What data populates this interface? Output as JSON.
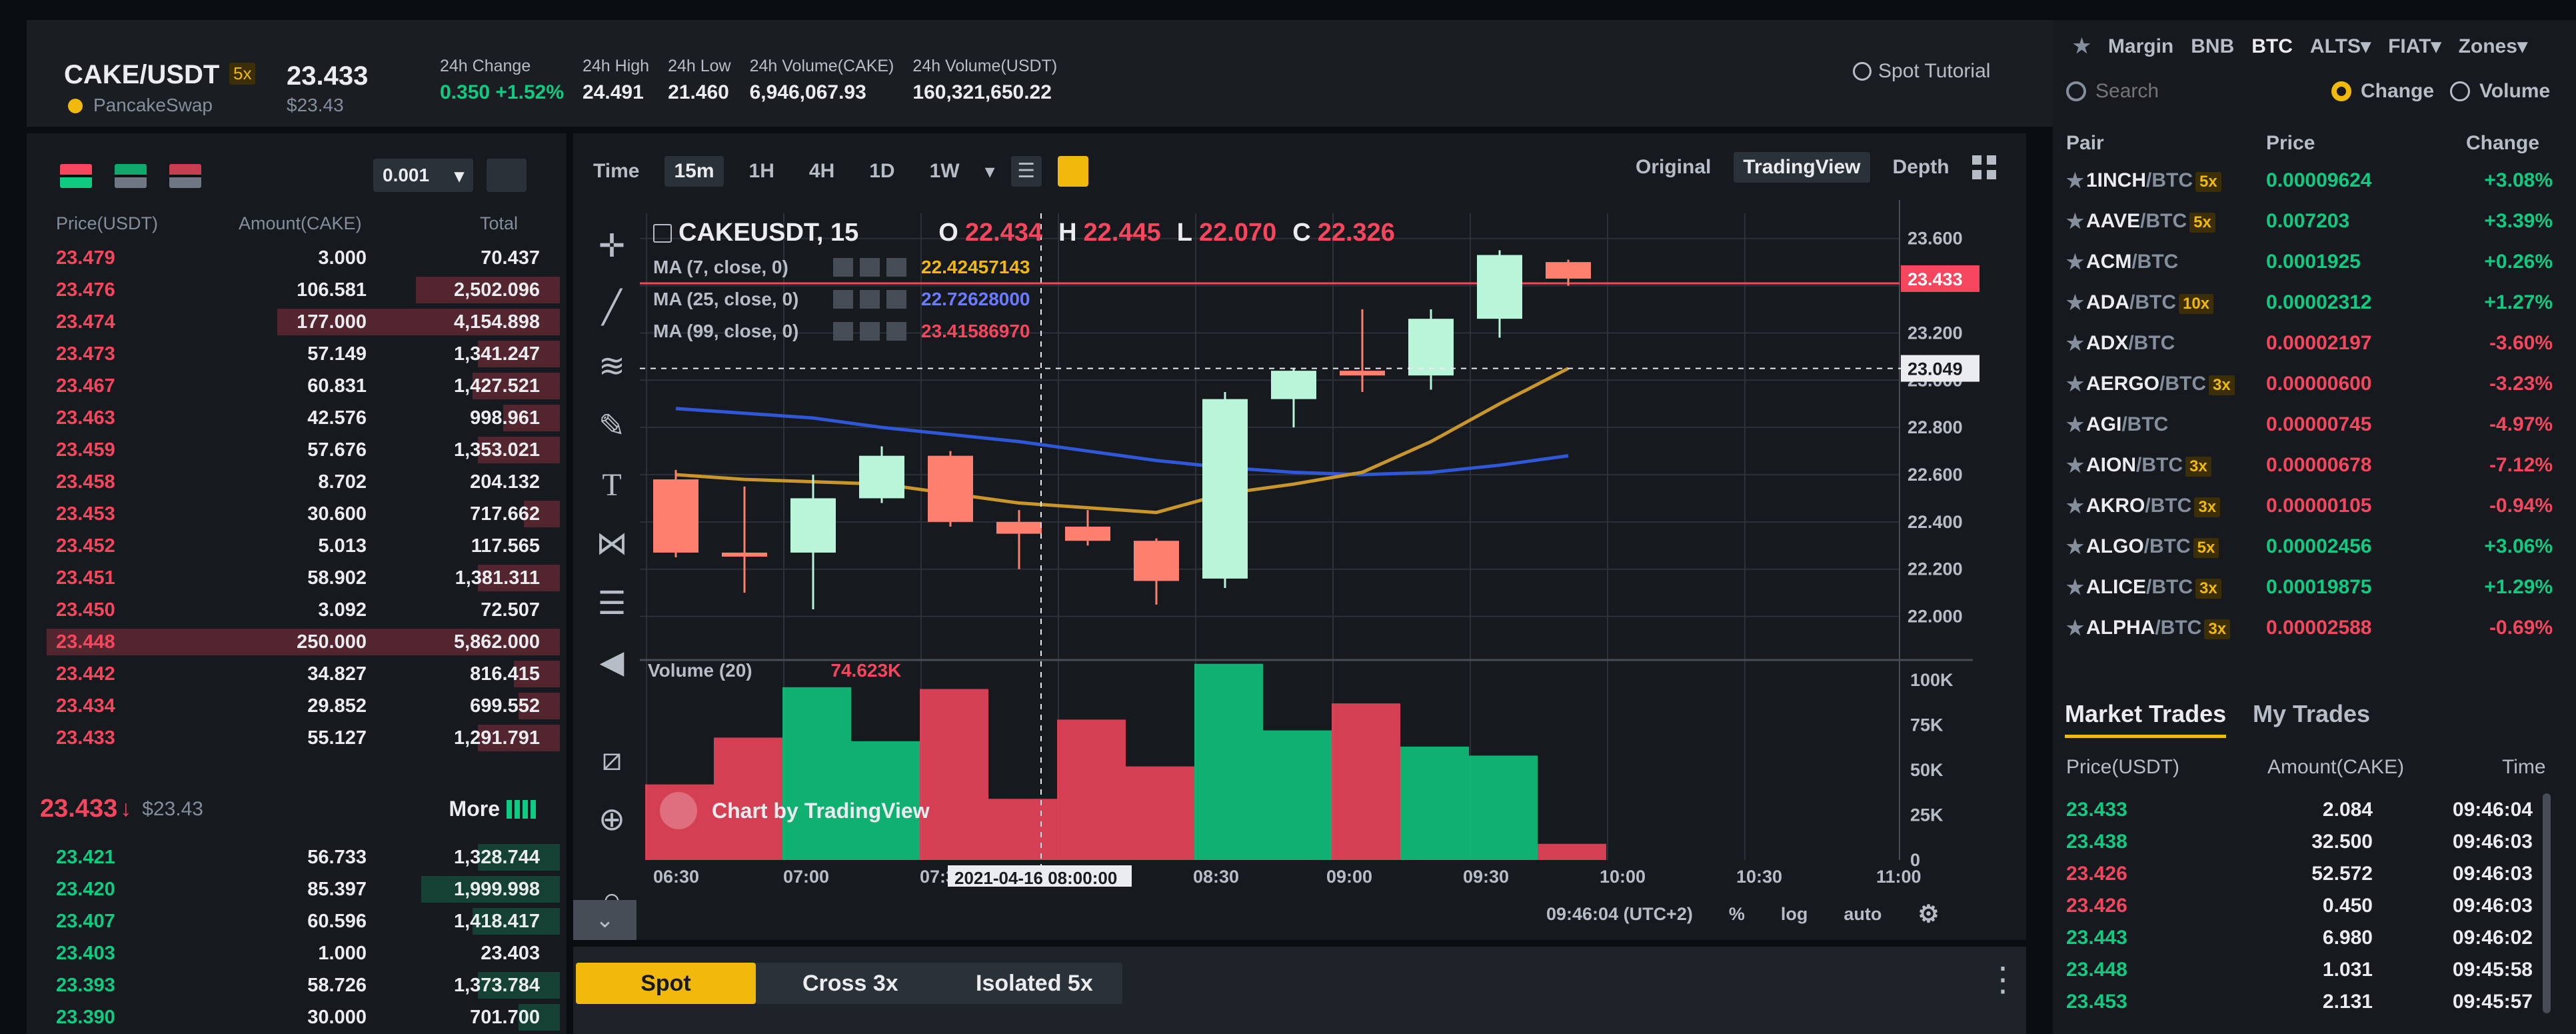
{
  "symbol": {
    "pair": "CAKE/USDT",
    "leverage": "5x",
    "price": "23.433",
    "price_usd": "$23.43",
    "source": "PancakeSwap",
    "stats": [
      {
        "label": "24h Change",
        "value": "0.350 +1.52%",
        "color": "#0ecb81"
      },
      {
        "label": "24h High",
        "value": "24.491"
      },
      {
        "label": "24h Low",
        "value": "21.460"
      },
      {
        "label": "24h Volume(CAKE)",
        "value": "6,946,067.93"
      },
      {
        "label": "24h Volume(USDT)",
        "value": "160,321,650.22"
      }
    ],
    "spot_tutorial": "Spot Tutorial"
  },
  "orderbook": {
    "depth_select": "0.001",
    "headers": [
      "Price(USDT)",
      "Amount(CAKE)",
      "Total"
    ],
    "asks": [
      {
        "price": "23.479",
        "amount": "3.000",
        "total": "70.437",
        "fill": 0.0
      },
      {
        "price": "23.476",
        "amount": "106.581",
        "total": "2,502.096",
        "fill": 0.28
      },
      {
        "price": "23.474",
        "amount": "177.000",
        "total": "4,154.898",
        "fill": 0.55
      },
      {
        "price": "23.473",
        "amount": "57.149",
        "total": "1,341.247",
        "fill": 0.16
      },
      {
        "price": "23.467",
        "amount": "60.831",
        "total": "1,427.521",
        "fill": 0.17
      },
      {
        "price": "23.463",
        "amount": "42.576",
        "total": "998.961",
        "fill": 0.11
      },
      {
        "price": "23.459",
        "amount": "57.676",
        "total": "1,353.021",
        "fill": 0.16
      },
      {
        "price": "23.458",
        "amount": "8.702",
        "total": "204.132",
        "fill": 0.0
      },
      {
        "price": "23.453",
        "amount": "30.600",
        "total": "717.662",
        "fill": 0.07
      },
      {
        "price": "23.452",
        "amount": "5.013",
        "total": "117.565",
        "fill": 0.0
      },
      {
        "price": "23.451",
        "amount": "58.902",
        "total": "1,381.311",
        "fill": 0.16
      },
      {
        "price": "23.450",
        "amount": "3.092",
        "total": "72.507",
        "fill": 0.0
      },
      {
        "price": "23.448",
        "amount": "250.000",
        "total": "5,862.000",
        "fill": 1.0
      },
      {
        "price": "23.442",
        "amount": "34.827",
        "total": "816.415",
        "fill": 0.09
      },
      {
        "price": "23.434",
        "amount": "29.852",
        "total": "699.552",
        "fill": 0.08
      },
      {
        "price": "23.433",
        "amount": "55.127",
        "total": "1,291.791",
        "fill": 0.16
      }
    ],
    "last_price": "23.433",
    "last_arrow": "↓",
    "last_usd": "$23.43",
    "more": "More",
    "bids": [
      {
        "price": "23.421",
        "amount": "56.733",
        "total": "1,328.744",
        "fill": 0.16
      },
      {
        "price": "23.420",
        "amount": "85.397",
        "total": "1,999.998",
        "fill": 0.27
      },
      {
        "price": "23.407",
        "amount": "60.596",
        "total": "1,418.417",
        "fill": 0.17
      },
      {
        "price": "23.403",
        "amount": "1.000",
        "total": "23.403",
        "fill": 0.0
      },
      {
        "price": "23.393",
        "amount": "58.726",
        "total": "1,373.784",
        "fill": 0.16
      },
      {
        "price": "23.390",
        "amount": "30.000",
        "total": "701.700",
        "fill": 0.08
      }
    ]
  },
  "chart_toolbar": {
    "timeframes": [
      "Time",
      "15m",
      "1H",
      "4H",
      "1D",
      "1W"
    ],
    "active": "15m",
    "views": [
      "Original",
      "TradingView",
      "Depth"
    ],
    "active_view": "TradingView"
  },
  "chart": {
    "symbol_label": "CAKEUSDT, 15",
    "ohlc": {
      "o": "22.434",
      "h": "22.445",
      "l": "22.070",
      "c": "22.326"
    },
    "ma": [
      {
        "label": "MA (7, close, 0)",
        "value": "22.42457143",
        "color": "#f0b90b"
      },
      {
        "label": "MA (25, close, 0)",
        "value": "22.72628000",
        "color": "#6b7bff"
      },
      {
        "label": "MA (99, close, 0)",
        "value": "23.41586970",
        "color": "#f6465d"
      }
    ],
    "price_tag": "23.433",
    "cross_tag": "23.049",
    "volume_label": "Volume (20)",
    "volume_value": "74.623K",
    "watermark": "Chart by TradingView",
    "cross_time": "2021-04-16 08:00:00",
    "clock": "09:46:04 (UTC+2)",
    "footer_opts": [
      "%",
      "log",
      "auto"
    ]
  },
  "chart_data": {
    "type": "candlestick",
    "ylim": [
      21.9,
      23.65
    ],
    "yticks": [
      "23.600",
      "23.400",
      "23.200",
      "23.000",
      "22.800",
      "22.600",
      "22.400",
      "22.200",
      "22.000"
    ],
    "vol_ticks": [
      "100K",
      "75K",
      "50K",
      "25K",
      "0"
    ],
    "vol_max": 100000,
    "xticks": [
      "06:30",
      "07:00",
      "07:30",
      "08:30",
      "09:00",
      "09:30",
      "10:00",
      "10:30",
      "11:00"
    ],
    "candles": [
      {
        "o": 22.58,
        "h": 22.62,
        "c": 22.27,
        "l": 22.25,
        "v": 42000
      },
      {
        "o": 22.27,
        "h": 22.55,
        "c": 22.26,
        "l": 22.1,
        "v": 68000
      },
      {
        "o": 22.27,
        "h": 22.6,
        "c": 22.5,
        "l": 22.03,
        "v": 96000
      },
      {
        "o": 22.5,
        "h": 22.72,
        "c": 22.68,
        "l": 22.48,
        "v": 66000
      },
      {
        "o": 22.68,
        "h": 22.7,
        "c": 22.4,
        "l": 22.38,
        "v": 95000
      },
      {
        "o": 22.4,
        "h": 22.45,
        "c": 22.35,
        "l": 22.2,
        "v": 34000
      },
      {
        "o": 22.38,
        "h": 22.45,
        "c": 22.32,
        "l": 22.3,
        "v": 78000
      },
      {
        "o": 22.32,
        "h": 22.33,
        "c": 22.15,
        "l": 22.05,
        "v": 52000
      },
      {
        "o": 22.16,
        "h": 22.95,
        "c": 22.92,
        "l": 22.12,
        "v": 109000
      },
      {
        "o": 22.92,
        "h": 23.05,
        "c": 23.04,
        "l": 22.8,
        "v": 72000
      },
      {
        "o": 23.04,
        "h": 23.3,
        "c": 23.02,
        "l": 22.95,
        "v": 87000
      },
      {
        "o": 23.02,
        "h": 23.3,
        "c": 23.26,
        "l": 22.96,
        "v": 63000
      },
      {
        "o": 23.26,
        "h": 23.55,
        "c": 23.53,
        "l": 23.18,
        "v": 58000
      },
      {
        "o": 23.5,
        "h": 23.51,
        "c": 23.43,
        "l": 23.4,
        "v": 9000
      }
    ],
    "ma25": [
      22.88,
      22.86,
      22.84,
      22.8,
      22.77,
      22.74,
      22.7,
      22.66,
      22.63,
      22.61,
      22.6,
      22.61,
      22.64,
      22.68
    ],
    "ma7": [
      22.6,
      22.58,
      22.57,
      22.56,
      22.52,
      22.48,
      22.46,
      22.44,
      22.52,
      22.56,
      22.61,
      22.74,
      22.9,
      23.05
    ]
  },
  "order_tabs": [
    "Spot",
    "Cross 3x",
    "Isolated 5x"
  ],
  "order_tabs_active": "Spot",
  "market": {
    "top_filters": [
      "Margin",
      "BNB",
      "BTC",
      "ALTS",
      "FIAT",
      "Zones"
    ],
    "active_filter": "BTC",
    "search_placeholder": "Search",
    "radio_change": "Change",
    "radio_volume": "Volume",
    "headers": [
      "Pair",
      "Price",
      "Change"
    ],
    "pairs": [
      {
        "base": "1INCH",
        "quote": "/BTC",
        "lev": "5x",
        "price": "0.00009624",
        "change": "+3.08%",
        "up": true
      },
      {
        "base": "AAVE",
        "quote": "/BTC",
        "lev": "5x",
        "price": "0.007203",
        "change": "+3.39%",
        "up": true
      },
      {
        "base": "ACM",
        "quote": "/BTC",
        "lev": "",
        "price": "0.0001925",
        "change": "+0.26%",
        "up": true
      },
      {
        "base": "ADA",
        "quote": "/BTC",
        "lev": "10x",
        "price": "0.00002312",
        "change": "+1.27%",
        "up": true
      },
      {
        "base": "ADX",
        "quote": "/BTC",
        "lev": "",
        "price": "0.00002197",
        "change": "-3.60%",
        "up": false
      },
      {
        "base": "AERGO",
        "quote": "/BTC",
        "lev": "3x",
        "price": "0.00000600",
        "change": "-3.23%",
        "up": false
      },
      {
        "base": "AGI",
        "quote": "/BTC",
        "lev": "",
        "price": "0.00000745",
        "change": "-4.97%",
        "up": false
      },
      {
        "base": "AION",
        "quote": "/BTC",
        "lev": "3x",
        "price": "0.00000678",
        "change": "-7.12%",
        "up": false
      },
      {
        "base": "AKRO",
        "quote": "/BTC",
        "lev": "3x",
        "price": "0.00000105",
        "change": "-0.94%",
        "up": false
      },
      {
        "base": "ALGO",
        "quote": "/BTC",
        "lev": "5x",
        "price": "0.00002456",
        "change": "+3.06%",
        "up": true
      },
      {
        "base": "ALICE",
        "quote": "/BTC",
        "lev": "3x",
        "price": "0.00019875",
        "change": "+1.29%",
        "up": true
      },
      {
        "base": "ALPHA",
        "quote": "/BTC",
        "lev": "3x",
        "price": "0.00002588",
        "change": "-0.69%",
        "up": false
      }
    ]
  },
  "trades": {
    "tabs": [
      "Market Trades",
      "My Trades"
    ],
    "headers": [
      "Price(USDT)",
      "Amount(CAKE)",
      "Time"
    ],
    "rows": [
      {
        "price": "23.433",
        "amount": "2.084",
        "time": "09:46:04",
        "up": true
      },
      {
        "price": "23.438",
        "amount": "32.500",
        "time": "09:46:03",
        "up": true
      },
      {
        "price": "23.426",
        "amount": "52.572",
        "time": "09:46:03",
        "up": false
      },
      {
        "price": "23.426",
        "amount": "0.450",
        "time": "09:46:03",
        "up": false
      },
      {
        "price": "23.443",
        "amount": "6.980",
        "time": "09:46:02",
        "up": true
      },
      {
        "price": "23.448",
        "amount": "1.031",
        "time": "09:45:58",
        "up": true
      },
      {
        "price": "23.453",
        "amount": "2.131",
        "time": "09:45:57",
        "up": true
      }
    ]
  }
}
